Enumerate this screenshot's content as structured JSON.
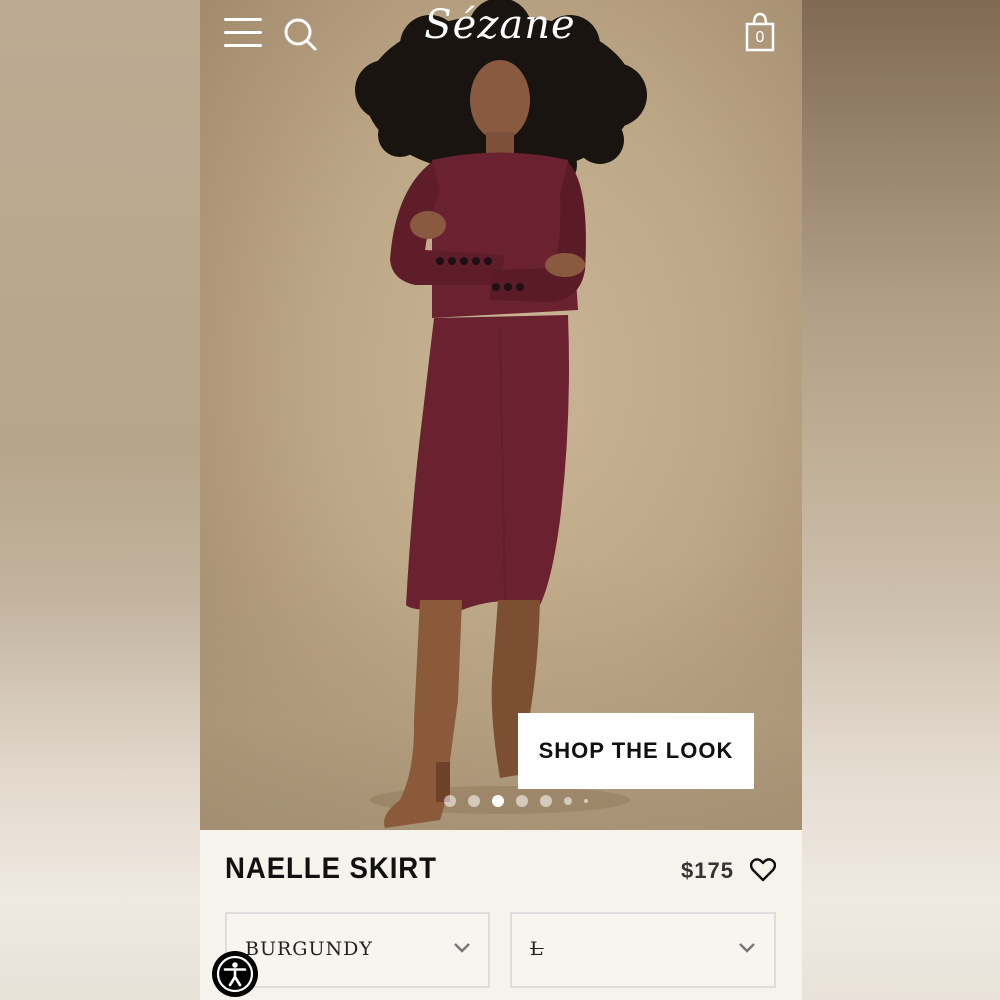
{
  "header": {
    "brand": "Sézane",
    "bag_count": "0",
    "menu_icon": "hamburger-menu-icon",
    "search_icon": "search-icon",
    "bag_icon": "shopping-bag-icon"
  },
  "hero": {
    "cta_label": "SHOP THE LOOK",
    "carousel": {
      "total": 7,
      "active_index": 2
    }
  },
  "product": {
    "name": "NAELLE SKIRT",
    "price": "$175",
    "color_select": {
      "value": "BURGUNDY"
    },
    "size_select": {
      "value": "L"
    },
    "wishlist_icon": "heart-icon"
  },
  "accessibility": {
    "icon": "accessibility-person-icon"
  },
  "colors": {
    "garment": "#6b2230",
    "boots": "#8a5a3a",
    "background": "#bca786",
    "panel": "#f6f3ed"
  }
}
